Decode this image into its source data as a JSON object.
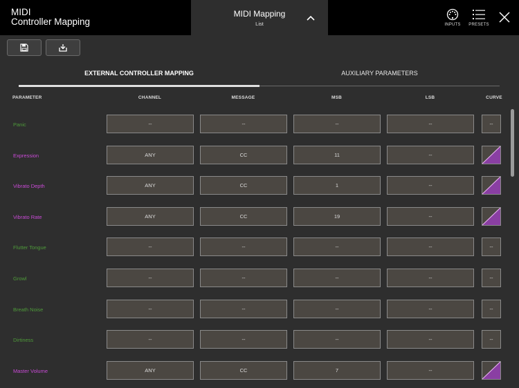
{
  "header": {
    "app_title_line1": "MIDI",
    "app_title_line2": "Controller Mapping",
    "panel_title": "MIDI Mapping",
    "panel_subtitle": "List",
    "inputs_label": "INPUTS",
    "presets_label": "PRESETS"
  },
  "tabs": [
    {
      "label": "EXTERNAL CONTROLLER MAPPING",
      "active": true
    },
    {
      "label": "AUXILIARY PARAMETERS",
      "active": false
    }
  ],
  "columns": [
    "PARAMETER",
    "CHANNEL",
    "MESSAGE",
    "MSB",
    "LSB",
    "CURVE"
  ],
  "colors": {
    "active_param": "#c94ad6",
    "inactive_param": "#4e9a3a",
    "curve_fill": "#8a3fa3"
  },
  "rows": [
    {
      "name": "Panic",
      "active": false,
      "channel": "--",
      "message": "--",
      "msb": "--",
      "lsb": "--",
      "curve": "--"
    },
    {
      "name": "Expression",
      "active": true,
      "channel": "ANY",
      "message": "CC",
      "msb": "11",
      "lsb": "--",
      "curve": ""
    },
    {
      "name": "Vibrato Depth",
      "active": true,
      "channel": "ANY",
      "message": "CC",
      "msb": "1",
      "lsb": "--",
      "curve": ""
    },
    {
      "name": "Vibrato Rate",
      "active": true,
      "channel": "ANY",
      "message": "CC",
      "msb": "19",
      "lsb": "--",
      "curve": ""
    },
    {
      "name": "Flutter Tongue",
      "active": false,
      "channel": "--",
      "message": "--",
      "msb": "--",
      "lsb": "--",
      "curve": "--"
    },
    {
      "name": "Growl",
      "active": false,
      "channel": "--",
      "message": "--",
      "msb": "--",
      "lsb": "--",
      "curve": "--"
    },
    {
      "name": "Breath Noise",
      "active": false,
      "channel": "--",
      "message": "--",
      "msb": "--",
      "lsb": "--",
      "curve": "--"
    },
    {
      "name": "Dirtiness",
      "active": false,
      "channel": "--",
      "message": "--",
      "msb": "--",
      "lsb": "--",
      "curve": "--"
    },
    {
      "name": "Master Volume",
      "active": true,
      "channel": "ANY",
      "message": "CC",
      "msb": "7",
      "lsb": "--",
      "curve": ""
    }
  ]
}
